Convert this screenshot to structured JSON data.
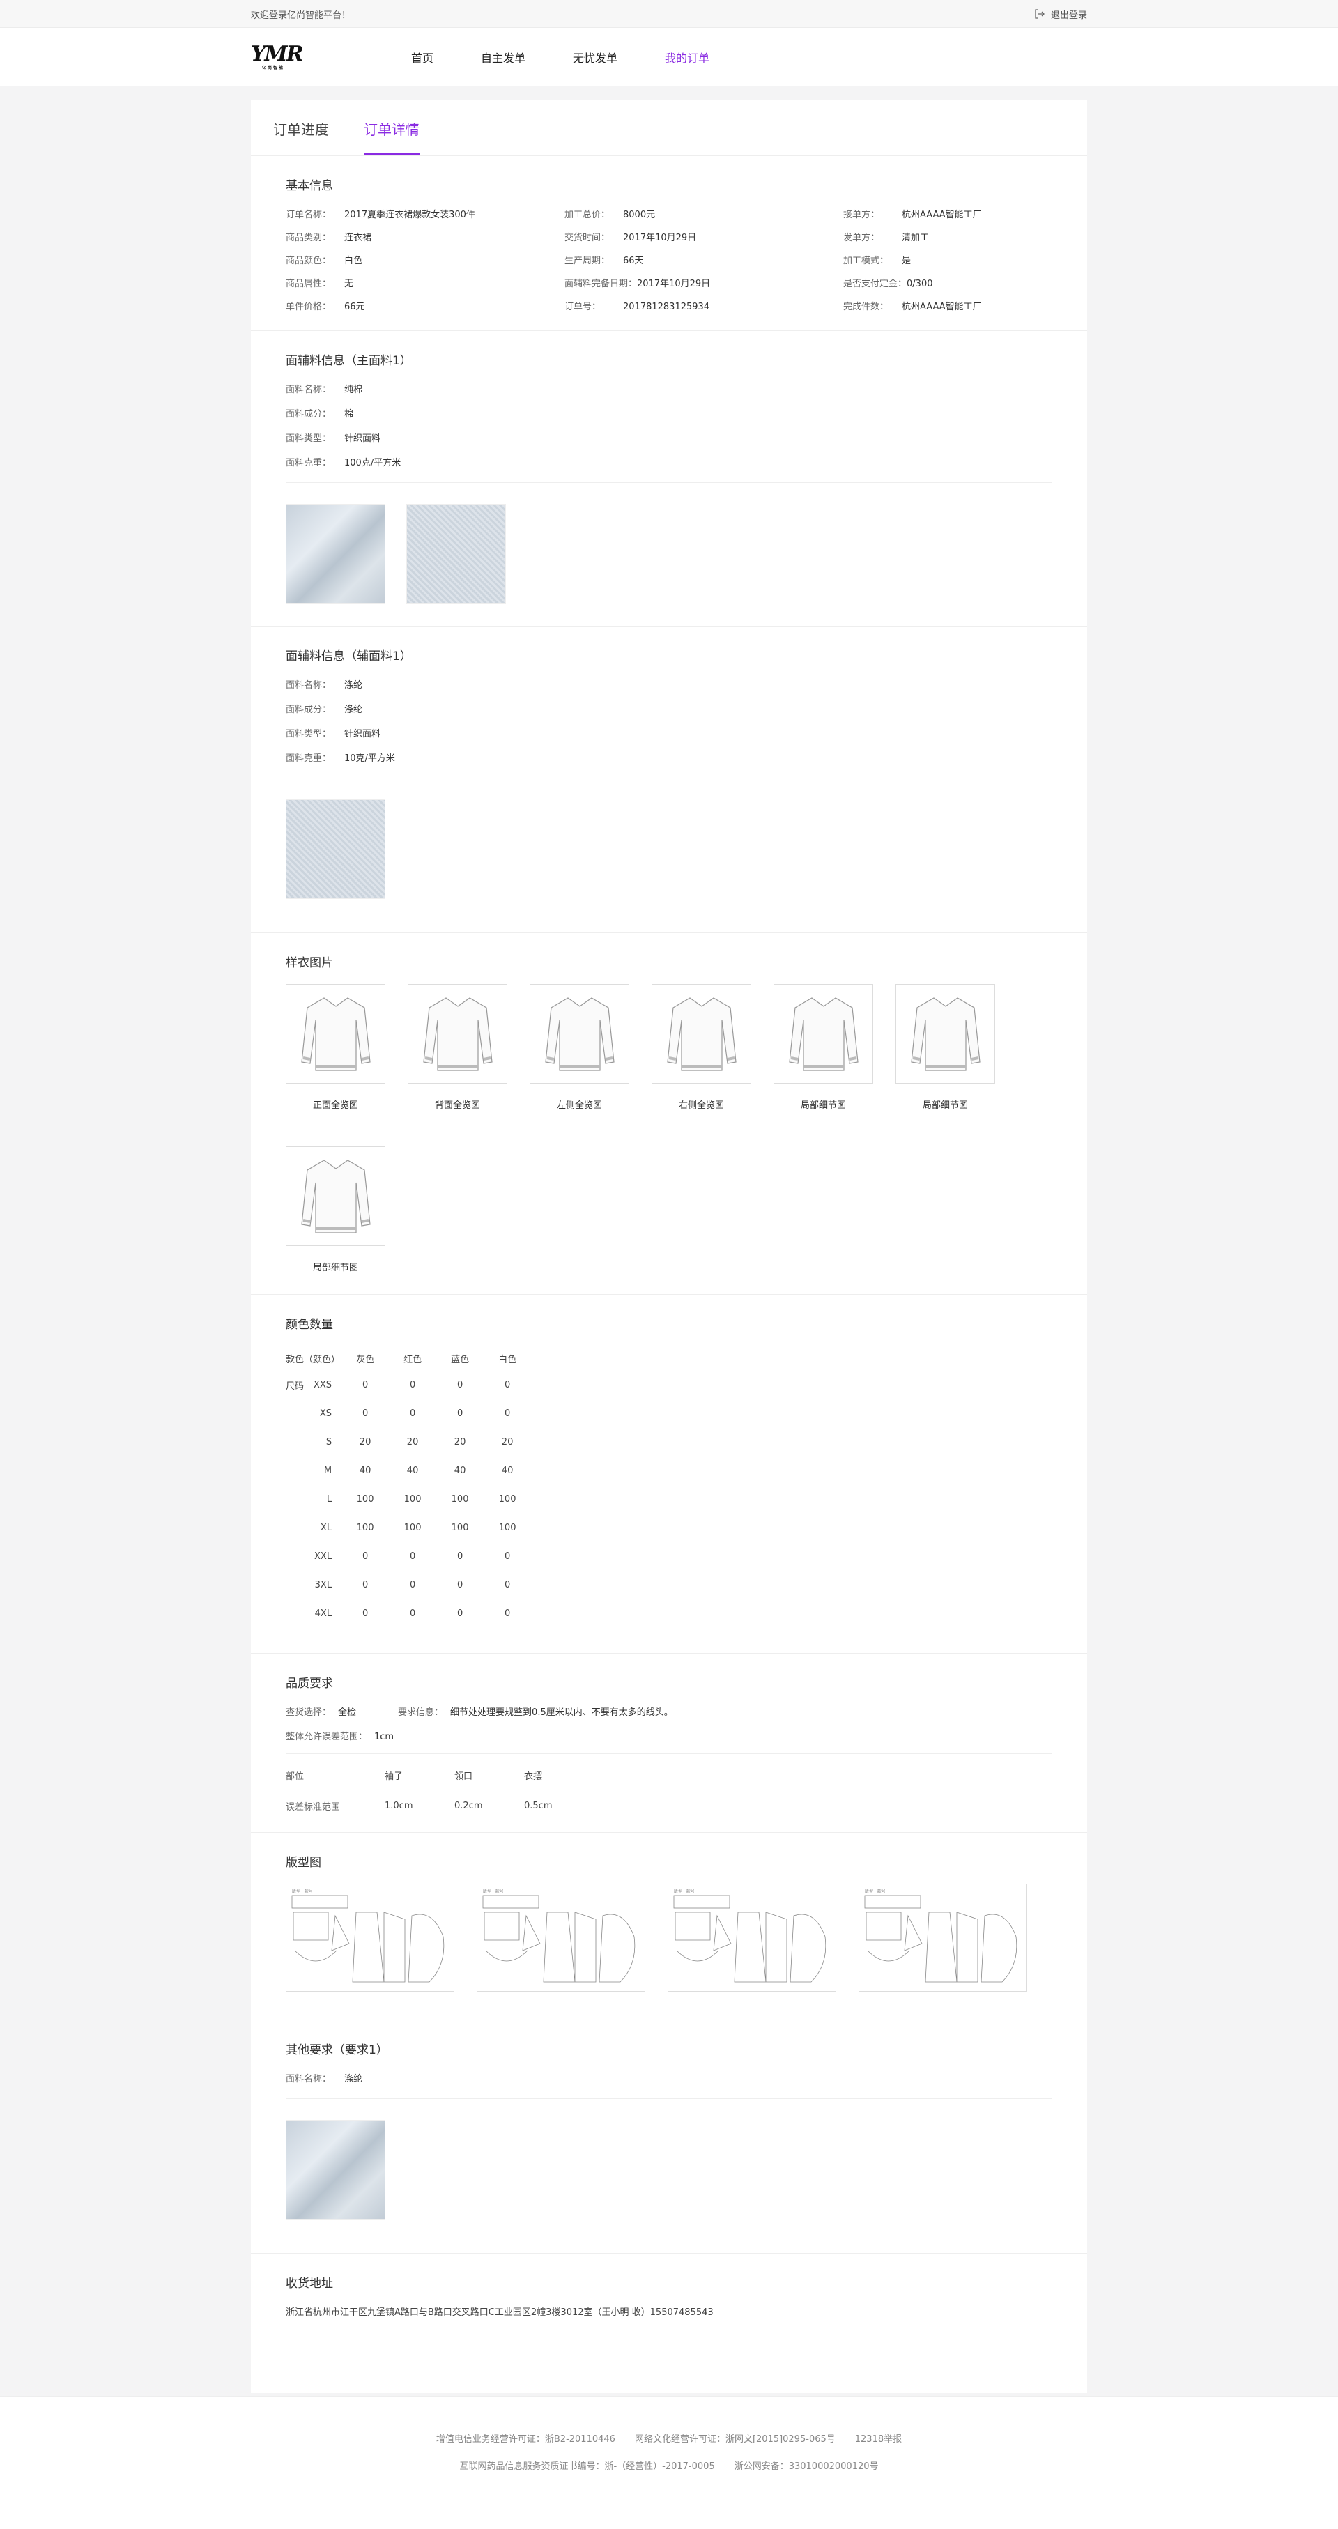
{
  "topbar": {
    "welcome": "欢迎登录亿尚智能平台！",
    "logout": "退出登录"
  },
  "nav": {
    "logo": "YMR",
    "logo_sub": "亿尚智能",
    "items": [
      "首页",
      "自主发单",
      "无忧发单",
      "我的订单"
    ]
  },
  "tabs": [
    "订单进度",
    "订单详情"
  ],
  "basic": {
    "title": "基本信息",
    "fields": [
      [
        "订单名称：",
        "2017夏季连衣裙爆款女装300件"
      ],
      [
        "加工总价：",
        "8000元"
      ],
      [
        "接单方：",
        "杭州AAAA智能工厂"
      ],
      [
        "商品类别：",
        "连衣裙"
      ],
      [
        "交货时间：",
        "2017年10月29日"
      ],
      [
        "发单方：",
        "清加工"
      ],
      [
        "商品颜色：",
        "白色"
      ],
      [
        "生产周期：",
        "66天"
      ],
      [
        "加工模式：",
        "是"
      ],
      [
        "商品属性：",
        "无"
      ],
      [
        "面辅料完备日期：",
        "2017年10月29日"
      ],
      [
        "是否支付定金：",
        "0/300"
      ],
      [
        "单件价格：",
        "66元"
      ],
      [
        "订单号：",
        "201781283125934"
      ],
      [
        "完成件数：",
        "杭州AAAA智能工厂"
      ]
    ]
  },
  "main_fabric": {
    "title": "面辅料信息（主面料1）",
    "fields": [
      [
        "面料名称：",
        "纯棉"
      ],
      [
        "面料成分：",
        "棉"
      ],
      [
        "面料类型：",
        "针织面料"
      ],
      [
        "面料克重：",
        "100克/平方米"
      ]
    ]
  },
  "aux_fabric": {
    "title": "面辅料信息（辅面料1）",
    "fields": [
      [
        "面料名称：",
        "涤纶"
      ],
      [
        "面料成分：",
        "涤纶"
      ],
      [
        "面料类型：",
        "针织面料"
      ],
      [
        "面料克重：",
        "10克/平方米"
      ]
    ]
  },
  "samples": {
    "title": "样衣图片",
    "row1": [
      "正面全览图",
      "背面全览图",
      "左侧全览图",
      "右侧全览图",
      "局部细节图",
      "局部细节图"
    ],
    "row2": [
      "局部细节图"
    ]
  },
  "colors": {
    "title": "颜色数量",
    "head_label": "款色（颜色）",
    "size_label": "尺码",
    "colors": [
      "灰色",
      "红色",
      "蓝色",
      "白色"
    ],
    "rows": [
      [
        "XXS",
        "0",
        "0",
        "0",
        "0"
      ],
      [
        "XS",
        "0",
        "0",
        "0",
        "0"
      ],
      [
        "S",
        "20",
        "20",
        "20",
        "20"
      ],
      [
        "M",
        "40",
        "40",
        "40",
        "40"
      ],
      [
        "L",
        "100",
        "100",
        "100",
        "100"
      ],
      [
        "XL",
        "100",
        "100",
        "100",
        "100"
      ],
      [
        "XXL",
        "0",
        "0",
        "0",
        "0"
      ],
      [
        "3XL",
        "0",
        "0",
        "0",
        "0"
      ],
      [
        "4XL",
        "0",
        "0",
        "0",
        "0"
      ]
    ]
  },
  "quality": {
    "title": "品质要求",
    "check_k": "查货选择：",
    "check_v": "全检",
    "req_k": "要求信息：",
    "req_v": "细节处处理要规整到0.5厘米以内、不要有太多的线头。",
    "range_k": "整体允许误差范围：",
    "range_v": "1cm",
    "tol_head": [
      "部位",
      "袖子",
      "领口",
      "衣摆"
    ],
    "tol_row": [
      "误差标准范围",
      "1.0cm",
      "0.2cm",
      "0.5cm"
    ]
  },
  "patterns": {
    "title": "版型图"
  },
  "other": {
    "title": "其他要求（要求1）",
    "k": "面料名称：",
    "v": "涤纶"
  },
  "address": {
    "title": "收货地址",
    "text": "浙江省杭州市江干区九堡镇A路口与B路口交叉路口C工业园区2幢3楼3012室（王小明 收）15507485543"
  },
  "footer": {
    "line1": [
      "增值电信业务经营许可证：浙B2-20110446",
      "网络文化经营许可证：浙网文[2015]0295-065号",
      "12318举报"
    ],
    "line2": [
      "互联网药品信息服务资质证书编号：浙-（经营性）-2017-0005",
      "浙公网安备：33010002000120号"
    ]
  }
}
